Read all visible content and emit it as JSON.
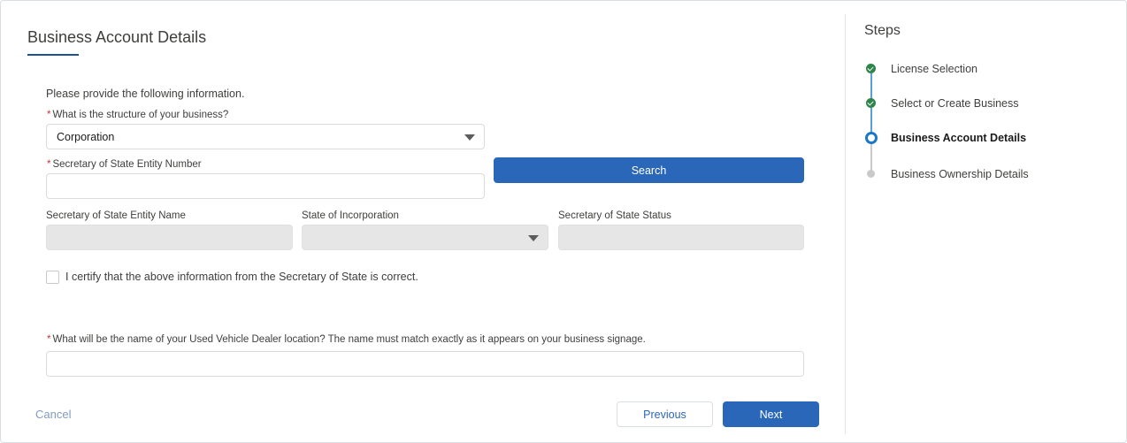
{
  "page": {
    "title": "Business Account Details"
  },
  "form": {
    "intro": "Please provide the following information.",
    "structure": {
      "required_mark": "*",
      "label": "What is the structure of your business?",
      "value": "Corporation"
    },
    "entity_number": {
      "required_mark": "*",
      "label": "Secretary of State Entity Number",
      "value": ""
    },
    "search_label": "Search",
    "entity_name": {
      "label": "Secretary of State Entity Name",
      "value": ""
    },
    "state": {
      "label": "State of Incorporation",
      "value": ""
    },
    "status": {
      "label": "Secretary of State Status",
      "value": ""
    },
    "certify": {
      "label": "I certify that the above information from the Secretary of State is correct.",
      "checked": false
    },
    "location_name": {
      "required_mark": "*",
      "label": "What will be the name of your Used Vehicle Dealer location?  The name must match exactly as it appears on your business signage.",
      "value": ""
    }
  },
  "footer": {
    "cancel_label": "Cancel",
    "previous_label": "Previous",
    "next_label": "Next"
  },
  "steps": {
    "title": "Steps",
    "items": [
      {
        "label": "License Selection",
        "state": "complete"
      },
      {
        "label": "Select or Create Business",
        "state": "complete"
      },
      {
        "label": "Business Account Details",
        "state": "current"
      },
      {
        "label": "Business Ownership Details",
        "state": "upcoming"
      }
    ]
  },
  "colors": {
    "brand": "#2a67b8",
    "complete": "#2e844a",
    "current": "#1b77c9",
    "required": "#c23934"
  }
}
